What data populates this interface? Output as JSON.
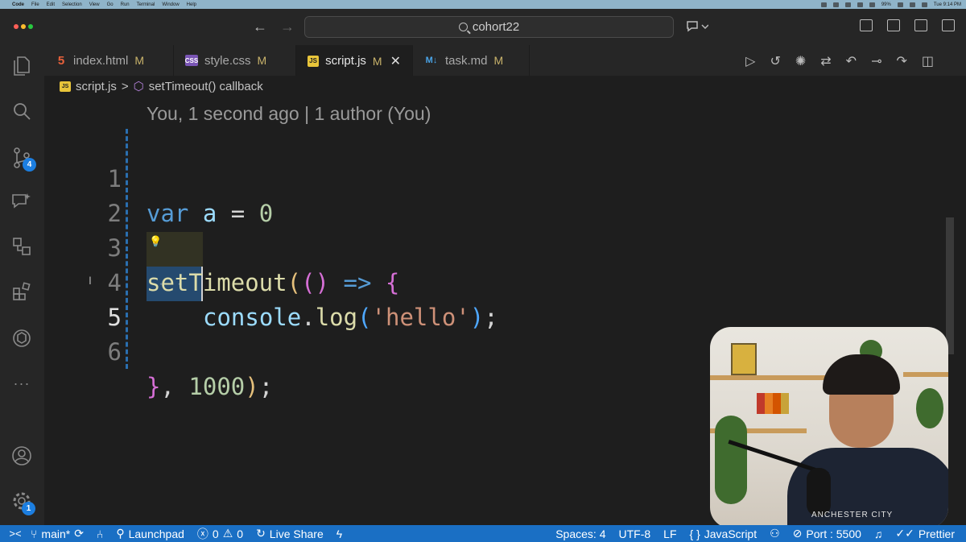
{
  "menubar": {
    "apple": "",
    "app": "Code",
    "items": [
      "File",
      "Edit",
      "Selection",
      "View",
      "Go",
      "Run",
      "Terminal",
      "Window",
      "Help"
    ],
    "battery": "99%",
    "clock": "Tue 9:14 PM"
  },
  "titlebar": {
    "search_text": "cohort22",
    "back_arrow": "←",
    "forward_arrow": "→"
  },
  "tabs": [
    {
      "icon": "html-file-icon",
      "glyph": "5",
      "label": "index.html",
      "status": "M",
      "active": false
    },
    {
      "icon": "css-file-icon",
      "glyph": "CSS",
      "label": "style.css",
      "status": "M",
      "active": false
    },
    {
      "icon": "js-file-icon",
      "glyph": "JS",
      "label": "script.js",
      "status": "M",
      "active": true
    },
    {
      "icon": "markdown-file-icon",
      "glyph": "M↓",
      "label": "task.md",
      "status": "M",
      "active": false
    }
  ],
  "tab_close": "✕",
  "breadcrumb": {
    "file": "script.js",
    "separator": ">",
    "symbol": "setTimeout() callback"
  },
  "codelens": "You, 1 second ago | 1 author (You)",
  "code": {
    "line_numbers": [
      "1",
      "2",
      "3",
      "4",
      "5",
      "6"
    ],
    "l1": {
      "kw": "var",
      "var": "a",
      "op": "=",
      "num": "0"
    },
    "l3": {
      "fn": "setTimeout",
      "p1_open": "(",
      "p2_open": "(",
      "p2_close": ")",
      "arrow": "=>",
      "brace_open": "{"
    },
    "l4": {
      "obj": "console",
      "dot": ".",
      "fn": "log",
      "p_open": "(",
      "str": "'hello'",
      "p_close": ")",
      "semi": ";"
    },
    "l5": {
      "dots": "····"
    },
    "l6": {
      "brace_close": "}",
      "comma": ",",
      "num": "1000",
      "p_close": ")",
      "semi": ";"
    }
  },
  "activity_badges": {
    "source_control": "4",
    "settings": "1"
  },
  "webcam": {
    "jersey_text": "ANCHESTER CITY"
  },
  "statusbar": {
    "remote": "><",
    "branch": "main*",
    "launchpad": "Launchpad",
    "errors": "0",
    "warnings": "0",
    "live_share": "Live Share",
    "spaces": "Spaces: 4",
    "encoding": "UTF-8",
    "eol": "LF",
    "language_braces": "{ }",
    "language": "JavaScript",
    "port": "Port : 5500",
    "prettier": "Prettier"
  },
  "colors": {
    "statusbar": "#1a6fc4",
    "accent_badge": "#1c7ee0",
    "keyword": "#569cd6",
    "string": "#ce9178",
    "number": "#b5cea8",
    "function": "#dcdcaa"
  }
}
